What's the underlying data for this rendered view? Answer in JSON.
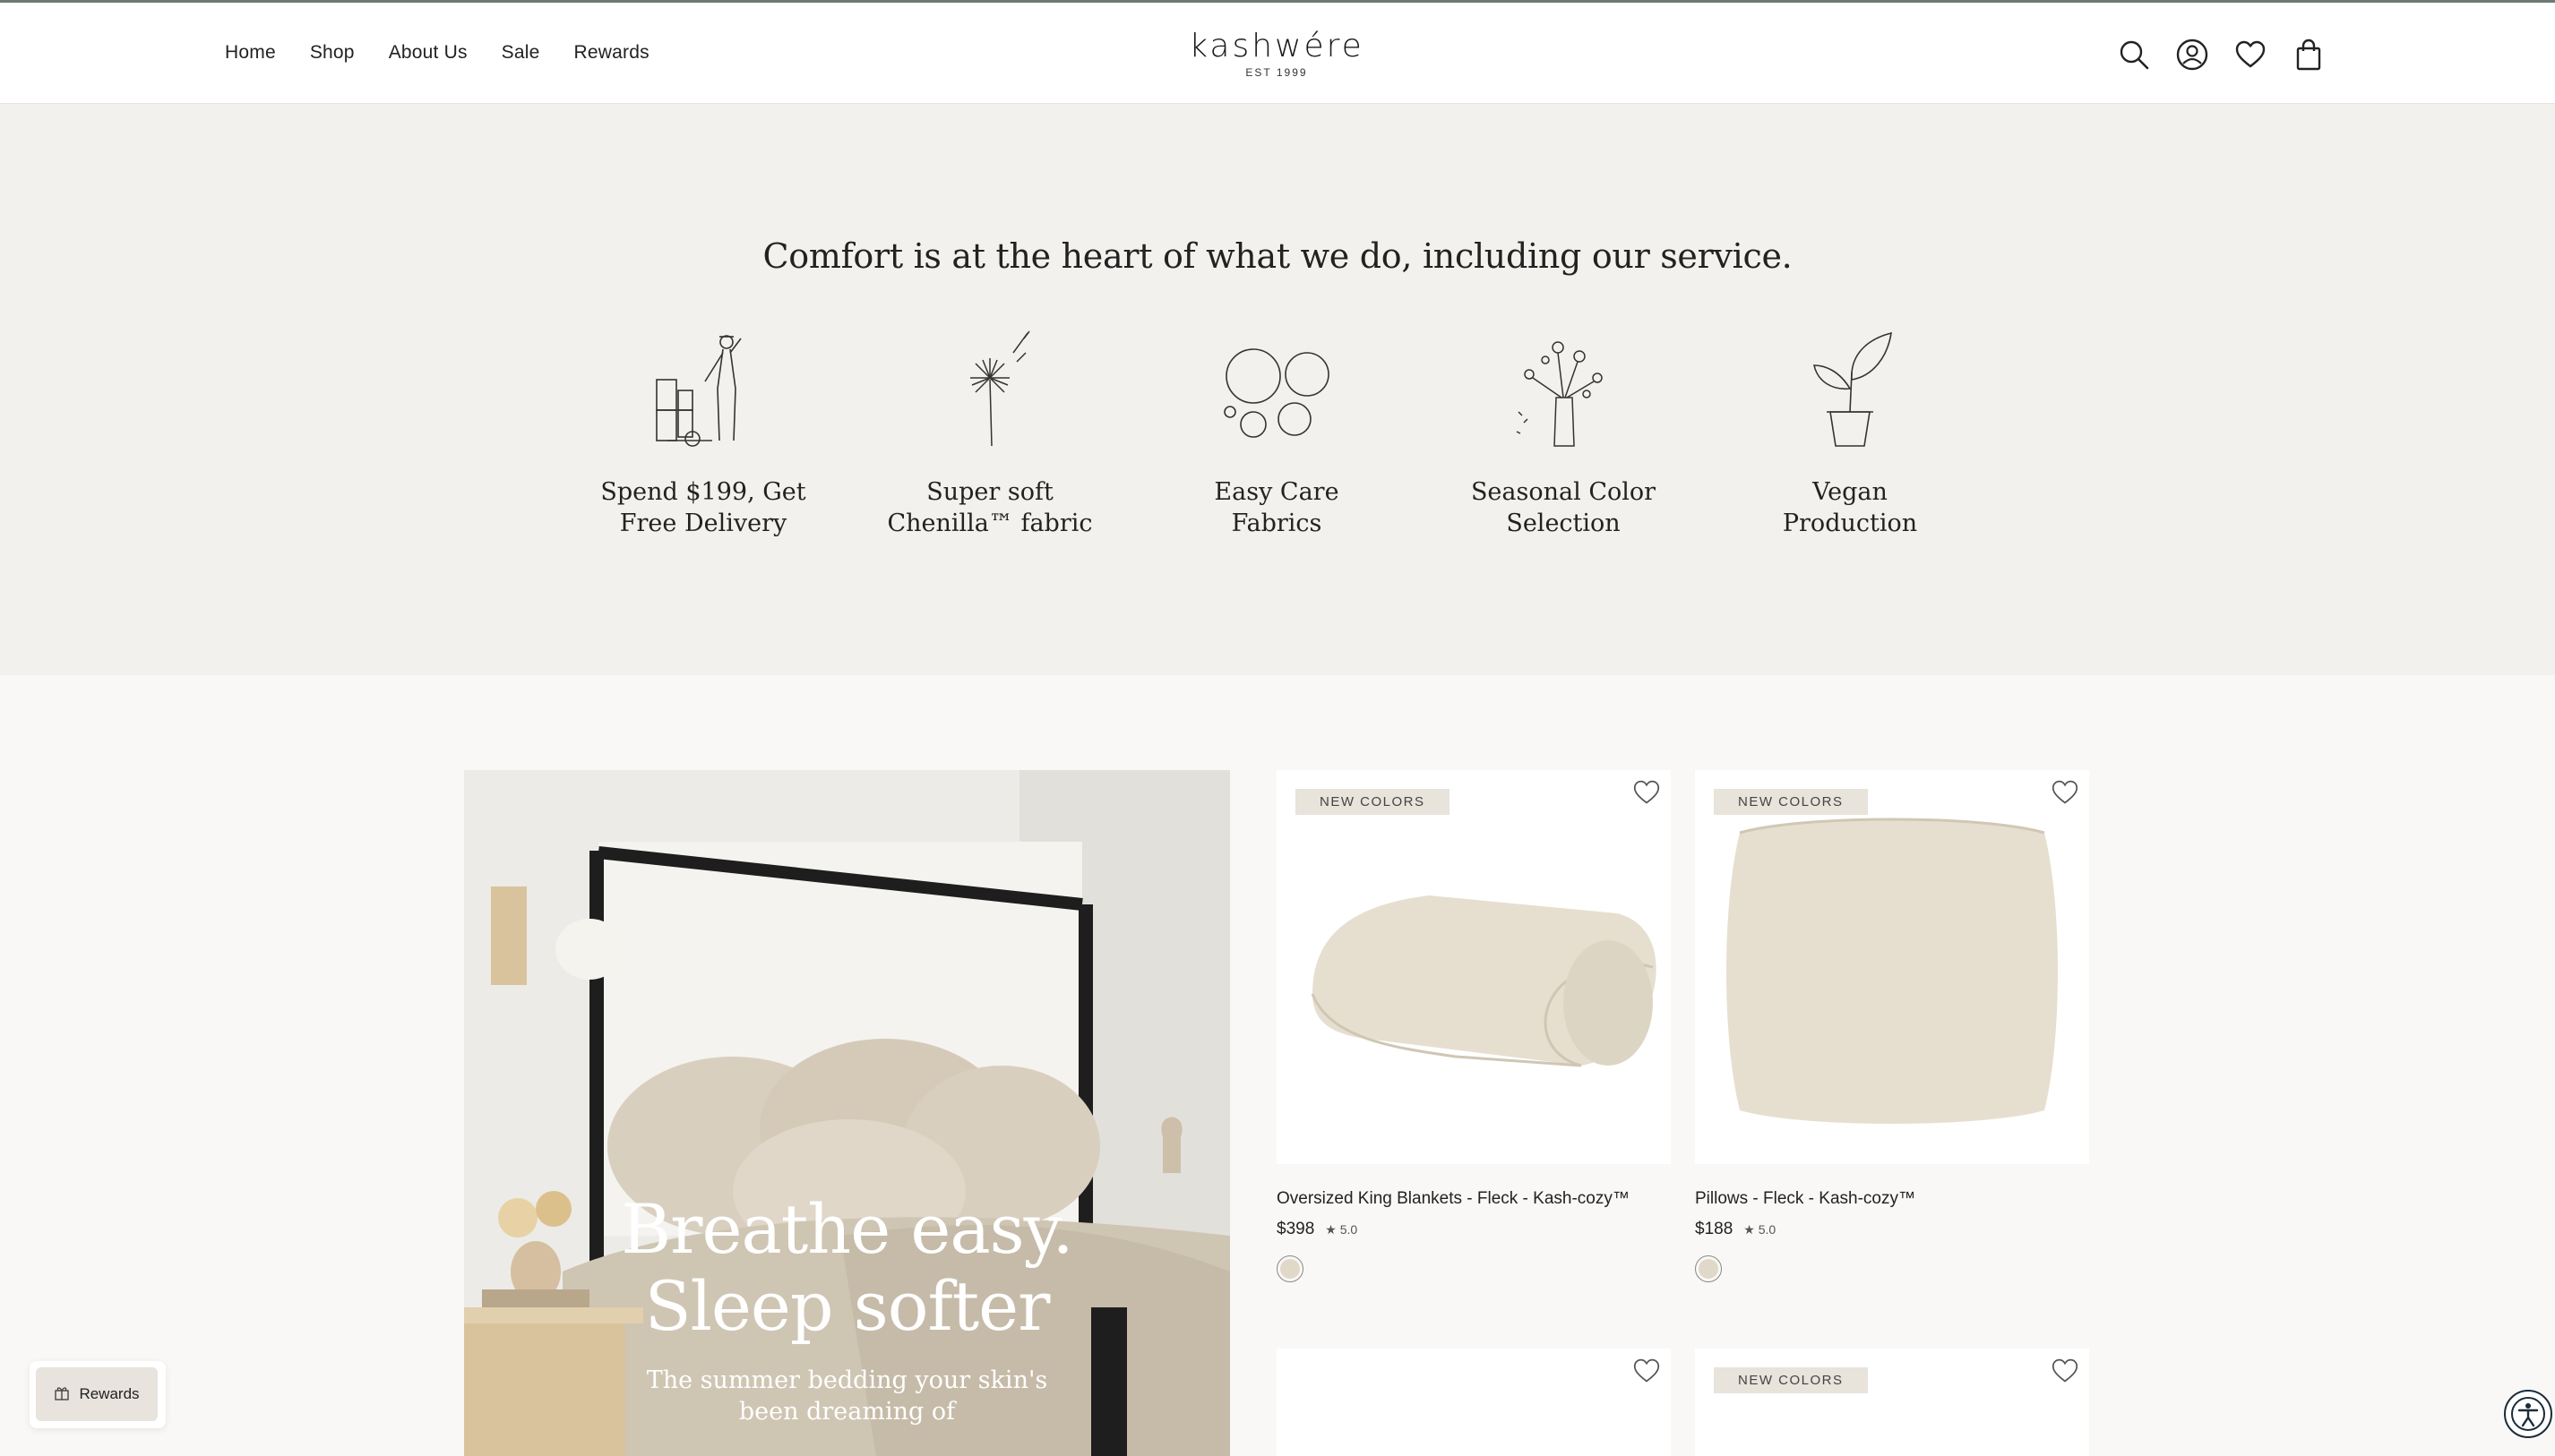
{
  "header": {
    "nav": [
      "Home",
      "Shop",
      "About Us",
      "Sale",
      "Rewards"
    ],
    "logo_text": "kashwére",
    "logo_sub": "EST 1999",
    "icons": [
      "search-icon",
      "account-icon",
      "wishlist-icon",
      "cart-icon"
    ]
  },
  "service": {
    "heading": "Comfort is at the heart of what we do, including our service.",
    "features": [
      {
        "line1": "Spend $199, Get",
        "line2": "Free Delivery",
        "icon": "delivery-icon"
      },
      {
        "line1": "Super soft",
        "line2": "Chenilla™ fabric",
        "icon": "dandelion-icon"
      },
      {
        "line1": "Easy Care",
        "line2": "Fabrics",
        "icon": "bubbles-icon"
      },
      {
        "line1": "Seasonal Color",
        "line2": "Selection",
        "icon": "flower-vase-icon"
      },
      {
        "line1": "Vegan",
        "line2": "Production",
        "icon": "plant-icon"
      }
    ]
  },
  "hero": {
    "title_line1": "Breathe easy.",
    "title_line2": "Sleep softer",
    "subtitle_line1": "The summer bedding your skin's",
    "subtitle_line2": "been dreaming of"
  },
  "products": [
    {
      "badge": "NEW COLORS",
      "title": "Oversized King Blankets - Fleck - Kash-cozy™",
      "price": "$398",
      "rating": "★ 5.0"
    },
    {
      "badge": "NEW COLORS",
      "title": "Pillows - Fleck - Kash-cozy™",
      "price": "$188",
      "rating": "★ 5.0"
    },
    {
      "badge": "",
      "title": "",
      "price": "",
      "rating": ""
    },
    {
      "badge": "NEW COLORS",
      "title": "",
      "price": "",
      "rating": ""
    }
  ],
  "rewards_button": "Rewards",
  "colors": {
    "band": "#f3f1ed",
    "page": "#f9f8f6",
    "badge": "#e8e3db",
    "swatch": "#e0d8c8"
  }
}
